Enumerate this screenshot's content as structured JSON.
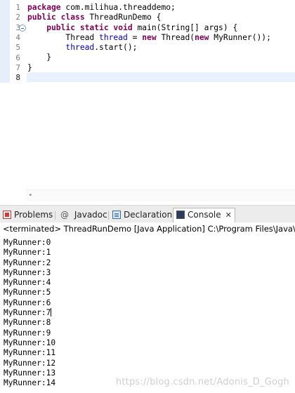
{
  "editor": {
    "line_numbers": [
      "1",
      "2",
      "3",
      "4",
      "5",
      "6",
      "7",
      "8"
    ],
    "lines": [
      [
        {
          "t": "package ",
          "c": "kw"
        },
        {
          "t": "com.milihua.threaddemo;",
          "c": ""
        }
      ],
      [
        {
          "t": "public class ",
          "c": "kw"
        },
        {
          "t": "ThreadRunDemo {",
          "c": ""
        }
      ],
      [
        {
          "t": "    public static void ",
          "c": "kw"
        },
        {
          "t": "main(String[] args) {",
          "c": ""
        }
      ],
      [
        {
          "t": "        Thread ",
          "c": ""
        },
        {
          "t": "thread",
          "c": "fld"
        },
        {
          "t": " = ",
          "c": ""
        },
        {
          "t": "new ",
          "c": "kw"
        },
        {
          "t": "Thread(",
          "c": ""
        },
        {
          "t": "new ",
          "c": "kw"
        },
        {
          "t": "MyRunner());",
          "c": ""
        }
      ],
      [
        {
          "t": "        ",
          "c": ""
        },
        {
          "t": "thread",
          "c": "fld"
        },
        {
          "t": ".start();",
          "c": ""
        }
      ],
      [
        {
          "t": "    }",
          "c": ""
        }
      ],
      [
        {
          "t": "}",
          "c": ""
        }
      ],
      [
        {
          "t": "",
          "c": ""
        }
      ]
    ]
  },
  "tabs": {
    "problems": "Problems",
    "javadoc_symbol": "@",
    "javadoc": "Javadoc",
    "declaration": "Declaration",
    "console": "Console",
    "close": "✕"
  },
  "console": {
    "status": "<terminated> ThreadRunDemo [Java Application] C:\\Program Files\\Java\\jdk",
    "output": [
      "MyRunner:0",
      "MyRunner:1",
      "MyRunner:2",
      "MyRunner:3",
      "MyRunner:4",
      "MyRunner:5",
      "MyRunner:6",
      "MyRunner:7",
      "MyRunner:8",
      "MyRunner:9",
      "MyRunner:10",
      "MyRunner:11",
      "MyRunner:12",
      "MyRunner:13",
      "MyRunner:14"
    ]
  },
  "watermark": "https://blog.csdn.net/Adonis_D_Gogh"
}
